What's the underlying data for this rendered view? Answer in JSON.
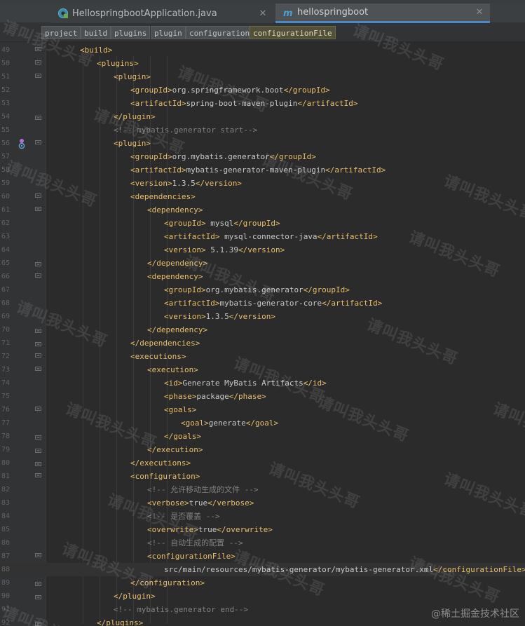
{
  "tabs": [
    {
      "label": "HellospringbootApplication.java",
      "icon": "java-class-icon",
      "active": false
    },
    {
      "label": "hellospringboot",
      "icon": "maven-icon",
      "active": true
    }
  ],
  "breadcrumb": [
    "project",
    "build",
    "plugins",
    "plugin",
    "configuration",
    "configurationFile"
  ],
  "lines": [
    {
      "n": "49",
      "indent": 2,
      "parts": [
        [
          "tag",
          "<build>"
        ]
      ]
    },
    {
      "n": "50",
      "indent": 3,
      "parts": [
        [
          "tag",
          "<plugins>"
        ]
      ]
    },
    {
      "n": "51",
      "indent": 4,
      "parts": [
        [
          "tag",
          "<plugin>"
        ]
      ]
    },
    {
      "n": "52",
      "indent": 5,
      "parts": [
        [
          "tag",
          "<groupId>"
        ],
        [
          "text",
          "org.springframework.boot"
        ],
        [
          "tag",
          "</groupId>"
        ]
      ]
    },
    {
      "n": "53",
      "indent": 5,
      "parts": [
        [
          "tag",
          "<artifactId>"
        ],
        [
          "text",
          "spring-boot-maven-plugin"
        ],
        [
          "tag",
          "</artifactId>"
        ]
      ]
    },
    {
      "n": "54",
      "indent": 4,
      "parts": [
        [
          "tag",
          "</plugin>"
        ]
      ]
    },
    {
      "n": "55",
      "indent": 4,
      "parts": [
        [
          "comment",
          "<!-- mybatis.generator start-->"
        ]
      ]
    },
    {
      "n": "56",
      "indent": 4,
      "parts": [
        [
          "tag",
          "<plugin>"
        ]
      ]
    },
    {
      "n": "57",
      "indent": 5,
      "parts": [
        [
          "tag",
          "<groupId>"
        ],
        [
          "text",
          "org.mybatis.generator"
        ],
        [
          "tag",
          "</groupId>"
        ]
      ]
    },
    {
      "n": "58",
      "indent": 5,
      "parts": [
        [
          "tag",
          "<artifactId>"
        ],
        [
          "text",
          "mybatis-generator-maven-plugin"
        ],
        [
          "tag",
          "</artifactId>"
        ]
      ]
    },
    {
      "n": "59",
      "indent": 5,
      "parts": [
        [
          "tag",
          "<version>"
        ],
        [
          "text",
          "1.3.5"
        ],
        [
          "tag",
          "</version>"
        ]
      ]
    },
    {
      "n": "60",
      "indent": 5,
      "parts": [
        [
          "tag",
          "<dependencies>"
        ]
      ]
    },
    {
      "n": "61",
      "indent": 6,
      "parts": [
        [
          "tag",
          "<dependency>"
        ]
      ]
    },
    {
      "n": "62",
      "indent": 7,
      "parts": [
        [
          "tag",
          "<groupId>"
        ],
        [
          "text",
          " mysql"
        ],
        [
          "tag",
          "</groupId>"
        ]
      ]
    },
    {
      "n": "63",
      "indent": 7,
      "parts": [
        [
          "tag",
          "<artifactId>"
        ],
        [
          "text",
          " mysql-connector-java"
        ],
        [
          "tag",
          "</artifactId>"
        ]
      ]
    },
    {
      "n": "64",
      "indent": 7,
      "parts": [
        [
          "tag",
          "<version>"
        ],
        [
          "text",
          " 5.1.39"
        ],
        [
          "tag",
          "</version>"
        ]
      ]
    },
    {
      "n": "65",
      "indent": 6,
      "parts": [
        [
          "tag",
          "</dependency>"
        ]
      ]
    },
    {
      "n": "66",
      "indent": 6,
      "parts": [
        [
          "tag",
          "<dependency>"
        ]
      ]
    },
    {
      "n": "67",
      "indent": 7,
      "parts": [
        [
          "tag",
          "<groupId>"
        ],
        [
          "text",
          "org.mybatis.generator"
        ],
        [
          "tag",
          "</groupId>"
        ]
      ]
    },
    {
      "n": "68",
      "indent": 7,
      "parts": [
        [
          "tag",
          "<artifactId>"
        ],
        [
          "text",
          "mybatis-generator-core"
        ],
        [
          "tag",
          "</artifactId>"
        ]
      ]
    },
    {
      "n": "69",
      "indent": 7,
      "parts": [
        [
          "tag",
          "<version>"
        ],
        [
          "text",
          "1.3.5"
        ],
        [
          "tag",
          "</version>"
        ]
      ]
    },
    {
      "n": "70",
      "indent": 6,
      "parts": [
        [
          "tag",
          "</dependency>"
        ]
      ]
    },
    {
      "n": "71",
      "indent": 5,
      "parts": [
        [
          "tag",
          "</dependencies>"
        ]
      ]
    },
    {
      "n": "72",
      "indent": 5,
      "parts": [
        [
          "tag",
          "<executions>"
        ]
      ]
    },
    {
      "n": "73",
      "indent": 6,
      "parts": [
        [
          "tag",
          "<execution>"
        ]
      ]
    },
    {
      "n": "74",
      "indent": 7,
      "parts": [
        [
          "tag",
          "<id>"
        ],
        [
          "text",
          "Generate MyBatis Artifacts"
        ],
        [
          "tag",
          "</id>"
        ]
      ]
    },
    {
      "n": "75",
      "indent": 7,
      "parts": [
        [
          "tag",
          "<phase>"
        ],
        [
          "text",
          "package"
        ],
        [
          "tag",
          "</phase>"
        ]
      ]
    },
    {
      "n": "76",
      "indent": 7,
      "parts": [
        [
          "tag",
          "<goals>"
        ]
      ]
    },
    {
      "n": "77",
      "indent": 8,
      "parts": [
        [
          "tag",
          "<goal>"
        ],
        [
          "text",
          "generate"
        ],
        [
          "tag",
          "</goal>"
        ]
      ]
    },
    {
      "n": "78",
      "indent": 7,
      "parts": [
        [
          "tag",
          "</goals>"
        ]
      ]
    },
    {
      "n": "79",
      "indent": 6,
      "parts": [
        [
          "tag",
          "</execution>"
        ]
      ]
    },
    {
      "n": "80",
      "indent": 5,
      "parts": [
        [
          "tag",
          "</executions>"
        ]
      ]
    },
    {
      "n": "81",
      "indent": 5,
      "parts": [
        [
          "tag",
          "<configuration>"
        ]
      ]
    },
    {
      "n": "82",
      "indent": 6,
      "parts": [
        [
          "comment",
          "<!-- 允许移动生成的文件 -->"
        ]
      ]
    },
    {
      "n": "83",
      "indent": 6,
      "parts": [
        [
          "tag",
          "<verbose>"
        ],
        [
          "text",
          "true"
        ],
        [
          "tag",
          "</verbose>"
        ]
      ]
    },
    {
      "n": "84",
      "indent": 6,
      "parts": [
        [
          "comment",
          "<!-- 是否覆盖 -->"
        ]
      ]
    },
    {
      "n": "85",
      "indent": 6,
      "parts": [
        [
          "tag",
          "<overwrite>"
        ],
        [
          "text",
          "true"
        ],
        [
          "tag",
          "</overwrite>"
        ]
      ]
    },
    {
      "n": "86",
      "indent": 6,
      "parts": [
        [
          "comment",
          "<!-- 自动生成的配置 -->"
        ]
      ]
    },
    {
      "n": "87",
      "indent": 6,
      "parts": [
        [
          "tag",
          "<configurationFile>"
        ]
      ]
    },
    {
      "n": "88",
      "indent": 7,
      "parts": [
        [
          "text",
          "src/main/resources/mybatis-generator/mybatis-generator.xml"
        ],
        [
          "tag",
          "</configurationFile>"
        ]
      ]
    },
    {
      "n": "89",
      "indent": 5,
      "parts": [
        [
          "tag",
          "</configuration>"
        ]
      ]
    },
    {
      "n": "90",
      "indent": 4,
      "parts": [
        [
          "tag",
          "</plugin>"
        ]
      ]
    },
    {
      "n": "91",
      "indent": 4,
      "parts": [
        [
          "comment",
          "<!-- mybatis.generator end-->"
        ]
      ]
    },
    {
      "n": "92",
      "indent": 3,
      "parts": [
        [
          "tag",
          "</plugins>"
        ]
      ]
    }
  ],
  "watermark": "请叫我头头哥",
  "corner_mark": "@稀土掘金技术社区",
  "colors": {
    "tag": "#e8bf6a",
    "text": "#c8c8c8",
    "comment": "#808080",
    "active_tab_underline": "#4a88c7"
  }
}
